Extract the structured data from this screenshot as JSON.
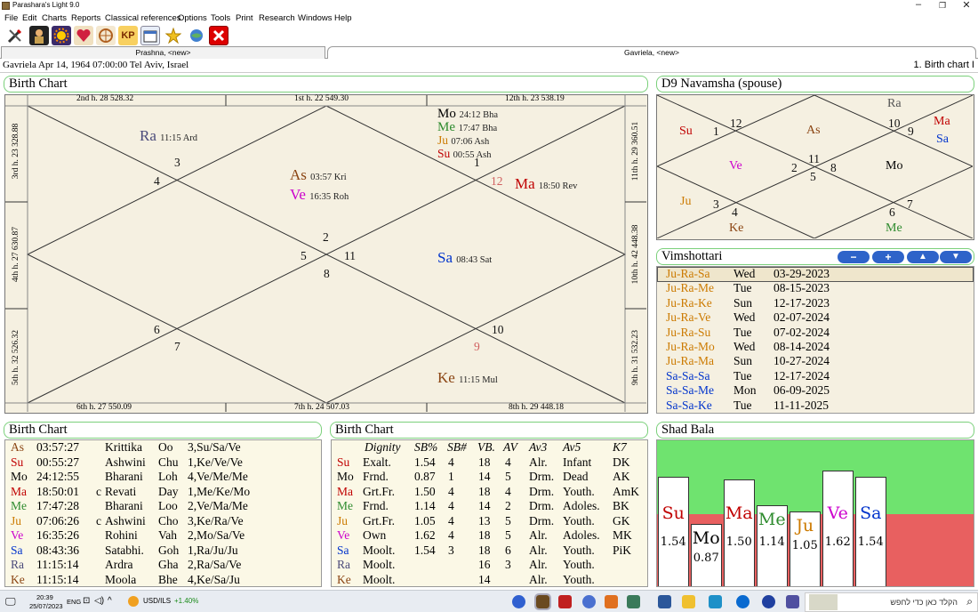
{
  "window": {
    "title": "Parashara's Light 9.0"
  },
  "menu": [
    "File",
    "Edit",
    "Charts",
    "Reports",
    "Classical references",
    "Options",
    "Tools",
    "Print",
    "Research",
    "Windows",
    "Help"
  ],
  "toolbar_icons": [
    "tools-icon",
    "person-icon",
    "sun-icon",
    "heart-icon",
    "compass-icon",
    "kp-icon",
    "calendar-icon",
    "star-icon",
    "globe-icon",
    "close-red-icon"
  ],
  "toolbar_kp_label": "KP",
  "tabs": [
    {
      "label": "Prashna,  <new>"
    },
    {
      "label": "Gavriela,  <new>"
    }
  ],
  "info": {
    "left": "Gavriela Apr 14, 1964 07:00:00  Tel Aviv, Israel",
    "right": "1. Birth chart I"
  },
  "birth_chart": {
    "title": "Birth Chart",
    "top_labels": [
      "2nd h.  28  528.32",
      "1st h.  22  549.30",
      "12th h.  23  538.19"
    ],
    "bottom_labels": [
      "6th h.  27  550.09",
      "7th h.  24  507.03",
      "8th h.  29  448.18"
    ],
    "left_labels": [
      "3rd h.  23  328.88",
      "4th h.  27  630.87",
      "5th h.  32  526.32"
    ],
    "right_labels": [
      "11th h.  29  360.51",
      "10th h.  42  448.38",
      "9th h.  31  532.23"
    ],
    "house_numbers": [
      "1",
      "2",
      "3",
      "4",
      "5",
      "6",
      "7",
      "8",
      "9",
      "10",
      "11",
      "12"
    ],
    "planets": [
      {
        "name": "Mo",
        "deg": "24:12 Bha",
        "color": "#000000"
      },
      {
        "name": "Me",
        "deg": "17:47 Bha",
        "color": "#2e8b2e"
      },
      {
        "name": "Ju",
        "deg": "07:06 Ash",
        "color": "#cc7a00"
      },
      {
        "name": "Su",
        "deg": "00:55 Ash",
        "color": "#c00000"
      },
      {
        "name": "Ra",
        "deg": "11:15 Ard",
        "color": "#4a4a7a"
      },
      {
        "name": "As",
        "deg": "03:57 Kri",
        "color": "#8b4513"
      },
      {
        "name": "Ve",
        "deg": "16:35 Roh",
        "color": "#cc00cc"
      },
      {
        "name": "Ma",
        "deg": "18:50 Rev",
        "color": "#c00000"
      },
      {
        "name": "Sa",
        "deg": "08:43 Sat",
        "color": "#0033cc"
      },
      {
        "name": "Ke",
        "deg": "11:15 Mul",
        "color": "#8b4513"
      }
    ]
  },
  "navamsha": {
    "title": "D9 Navamsha  (spouse)",
    "house_numbers": [
      "1",
      "2",
      "3",
      "4",
      "5",
      "6",
      "7",
      "8",
      "9",
      "10",
      "11",
      "12"
    ],
    "planets": [
      {
        "name": "Ra",
        "color": "#555555"
      },
      {
        "name": "Ma",
        "color": "#c00000"
      },
      {
        "name": "Sa",
        "color": "#0033cc"
      },
      {
        "name": "Su",
        "color": "#c00000"
      },
      {
        "name": "As",
        "color": "#8b4513"
      },
      {
        "name": "Ve",
        "color": "#cc00cc"
      },
      {
        "name": "Mo",
        "color": "#000000"
      },
      {
        "name": "Ju",
        "color": "#cc7a00"
      },
      {
        "name": "Ke",
        "color": "#8b4513"
      },
      {
        "name": "Me",
        "color": "#2e8b2e"
      }
    ]
  },
  "vimshottari": {
    "title": "Vimshottari",
    "buttons": [
      "−",
      "+",
      "▲",
      "▼"
    ],
    "rows": [
      {
        "p": "Ju-Ra-Sa",
        "day": "Wed",
        "date": "03-29-2023",
        "color": "#cc7a00"
      },
      {
        "p": "Ju-Ra-Me",
        "day": "Tue",
        "date": "08-15-2023",
        "color": "#cc7a00"
      },
      {
        "p": "Ju-Ra-Ke",
        "day": "Sun",
        "date": "12-17-2023",
        "color": "#cc7a00"
      },
      {
        "p": "Ju-Ra-Ve",
        "day": "Wed",
        "date": "02-07-2024",
        "color": "#cc7a00"
      },
      {
        "p": "Ju-Ra-Su",
        "day": "Tue",
        "date": "07-02-2024",
        "color": "#cc7a00"
      },
      {
        "p": "Ju-Ra-Mo",
        "day": "Wed",
        "date": "08-14-2024",
        "color": "#cc7a00"
      },
      {
        "p": "Ju-Ra-Ma",
        "day": "Sun",
        "date": "10-27-2024",
        "color": "#cc7a00"
      },
      {
        "p": "Sa-Sa-Sa",
        "day": "Tue",
        "date": "12-17-2024",
        "color": "#0033cc"
      },
      {
        "p": "Sa-Sa-Me",
        "day": "Mon",
        "date": "06-09-2025",
        "color": "#0033cc"
      },
      {
        "p": "Sa-Sa-Ke",
        "day": "Tue",
        "date": "11-11-2025",
        "color": "#0033cc"
      }
    ]
  },
  "birth_table": {
    "title": "Birth Chart",
    "rows": [
      {
        "p": "As",
        "t": "03:57:27",
        "c": "",
        "nak": "Krittika",
        "pada": "Oo",
        "lords": "3,Su/Sa/Ve",
        "color": "#8b4513"
      },
      {
        "p": "Su",
        "t": "00:55:27",
        "c": "",
        "nak": "Ashwini",
        "pada": "Chu",
        "lords": "1,Ke/Ve/Ve",
        "color": "#c00000"
      },
      {
        "p": "Mo",
        "t": "24:12:55",
        "c": "",
        "nak": "Bharani",
        "pada": "Loh",
        "lords": "4,Ve/Me/Me",
        "color": "#000000"
      },
      {
        "p": "Ma",
        "t": "18:50:01",
        "c": "c",
        "nak": "Revati",
        "pada": "Day",
        "lords": "1,Me/Ke/Mo",
        "color": "#c00000"
      },
      {
        "p": "Me",
        "t": "17:47:28",
        "c": "",
        "nak": "Bharani",
        "pada": "Loo",
        "lords": "2,Ve/Ma/Me",
        "color": "#2e8b2e"
      },
      {
        "p": "Ju",
        "t": "07:06:26",
        "c": "c",
        "nak": "Ashwini",
        "pada": "Cho",
        "lords": "3,Ke/Ra/Ve",
        "color": "#cc7a00"
      },
      {
        "p": "Ve",
        "t": "16:35:26",
        "c": "",
        "nak": "Rohini",
        "pada": "Vah",
        "lords": "2,Mo/Sa/Ve",
        "color": "#cc00cc"
      },
      {
        "p": "Sa",
        "t": "08:43:36",
        "c": "",
        "nak": "Satabhi.",
        "pada": "Goh",
        "lords": "1,Ra/Ju/Ju",
        "color": "#0033cc"
      },
      {
        "p": "Ra",
        "t": "11:15:14",
        "c": "",
        "nak": "Ardra",
        "pada": "Gha",
        "lords": "2,Ra/Sa/Ve",
        "color": "#4a4a7a"
      },
      {
        "p": "Ke",
        "t": "11:15:14",
        "c": "",
        "nak": "Moola",
        "pada": "Bhe",
        "lords": "4,Ke/Sa/Ju",
        "color": "#8b4513"
      }
    ]
  },
  "dignity_table": {
    "title": "Birth Chart",
    "headers": [
      "Dignity",
      "SB%",
      "SB#",
      "VB.",
      "AV",
      "Av3",
      "Av5",
      "K7"
    ],
    "rows": [
      {
        "p": "Su",
        "dig": "Exalt.",
        "sbp": "1.54",
        "sbn": "4",
        "vb": "18",
        "av": "4",
        "av3": "Alr.",
        "av5": "Infant",
        "k7": "DK",
        "color": "#c00000"
      },
      {
        "p": "Mo",
        "dig": "Frnd.",
        "sbp": "0.87",
        "sbn": "1",
        "vb": "14",
        "av": "5",
        "av3": "Drm.",
        "av5": "Dead",
        "k7": "AK",
        "color": "#000000"
      },
      {
        "p": "Ma",
        "dig": "Grt.Fr.",
        "sbp": "1.50",
        "sbn": "4",
        "vb": "18",
        "av": "4",
        "av3": "Drm.",
        "av5": "Youth.",
        "k7": "AmK",
        "color": "#c00000"
      },
      {
        "p": "Me",
        "dig": "Frnd.",
        "sbp": "1.14",
        "sbn": "4",
        "vb": "14",
        "av": "2",
        "av3": "Drm.",
        "av5": "Adoles.",
        "k7": "BK",
        "color": "#2e8b2e"
      },
      {
        "p": "Ju",
        "dig": "Grt.Fr.",
        "sbp": "1.05",
        "sbn": "4",
        "vb": "13",
        "av": "5",
        "av3": "Drm.",
        "av5": "Youth.",
        "k7": "GK",
        "color": "#cc7a00"
      },
      {
        "p": "Ve",
        "dig": "Own",
        "sbp": "1.62",
        "sbn": "4",
        "vb": "18",
        "av": "5",
        "av3": "Alr.",
        "av5": "Adoles.",
        "k7": "MK",
        "color": "#cc00cc"
      },
      {
        "p": "Sa",
        "dig": "Moolt.",
        "sbp": "1.54",
        "sbn": "3",
        "vb": "18",
        "av": "6",
        "av3": "Alr.",
        "av5": "Youth.",
        "k7": "PiK",
        "color": "#0033cc"
      },
      {
        "p": "Ra",
        "dig": "Moolt.",
        "sbp": "",
        "sbn": "",
        "vb": "16",
        "av": "3",
        "av3": "Alr.",
        "av5": "Youth.",
        "k7": "",
        "color": "#4a4a7a"
      },
      {
        "p": "Ke",
        "dig": "Moolt.",
        "sbp": "",
        "sbn": "",
        "vb": "14",
        "av": "",
        "av3": "Alr.",
        "av5": "Youth.",
        "k7": "",
        "color": "#8b4513"
      }
    ]
  },
  "shad_bala": {
    "title": "Shad Bala",
    "bars": [
      {
        "p": "Su",
        "val": "1.54",
        "num": 1.54,
        "color": "#c00000"
      },
      {
        "p": "Mo",
        "val": "0.87",
        "num": 0.87,
        "color": "#000000"
      },
      {
        "p": "Ma",
        "val": "1.50",
        "num": 1.5,
        "color": "#c00000"
      },
      {
        "p": "Me",
        "val": "1.14",
        "num": 1.14,
        "color": "#2e8b2e"
      },
      {
        "p": "Ju",
        "val": "1.05",
        "num": 1.05,
        "color": "#cc7a00"
      },
      {
        "p": "Ve",
        "val": "1.62",
        "num": 1.62,
        "color": "#cc00cc"
      },
      {
        "p": "Sa",
        "val": "1.54",
        "num": 1.54,
        "color": "#0033cc"
      }
    ]
  },
  "taskbar": {
    "time": "20:39",
    "date": "25/07/2023",
    "lang": "ENG",
    "ticker": "USD/ILS",
    "ticker_change": "+1.40%",
    "search_placeholder": "הקלד כאן כדי לחפש"
  }
}
